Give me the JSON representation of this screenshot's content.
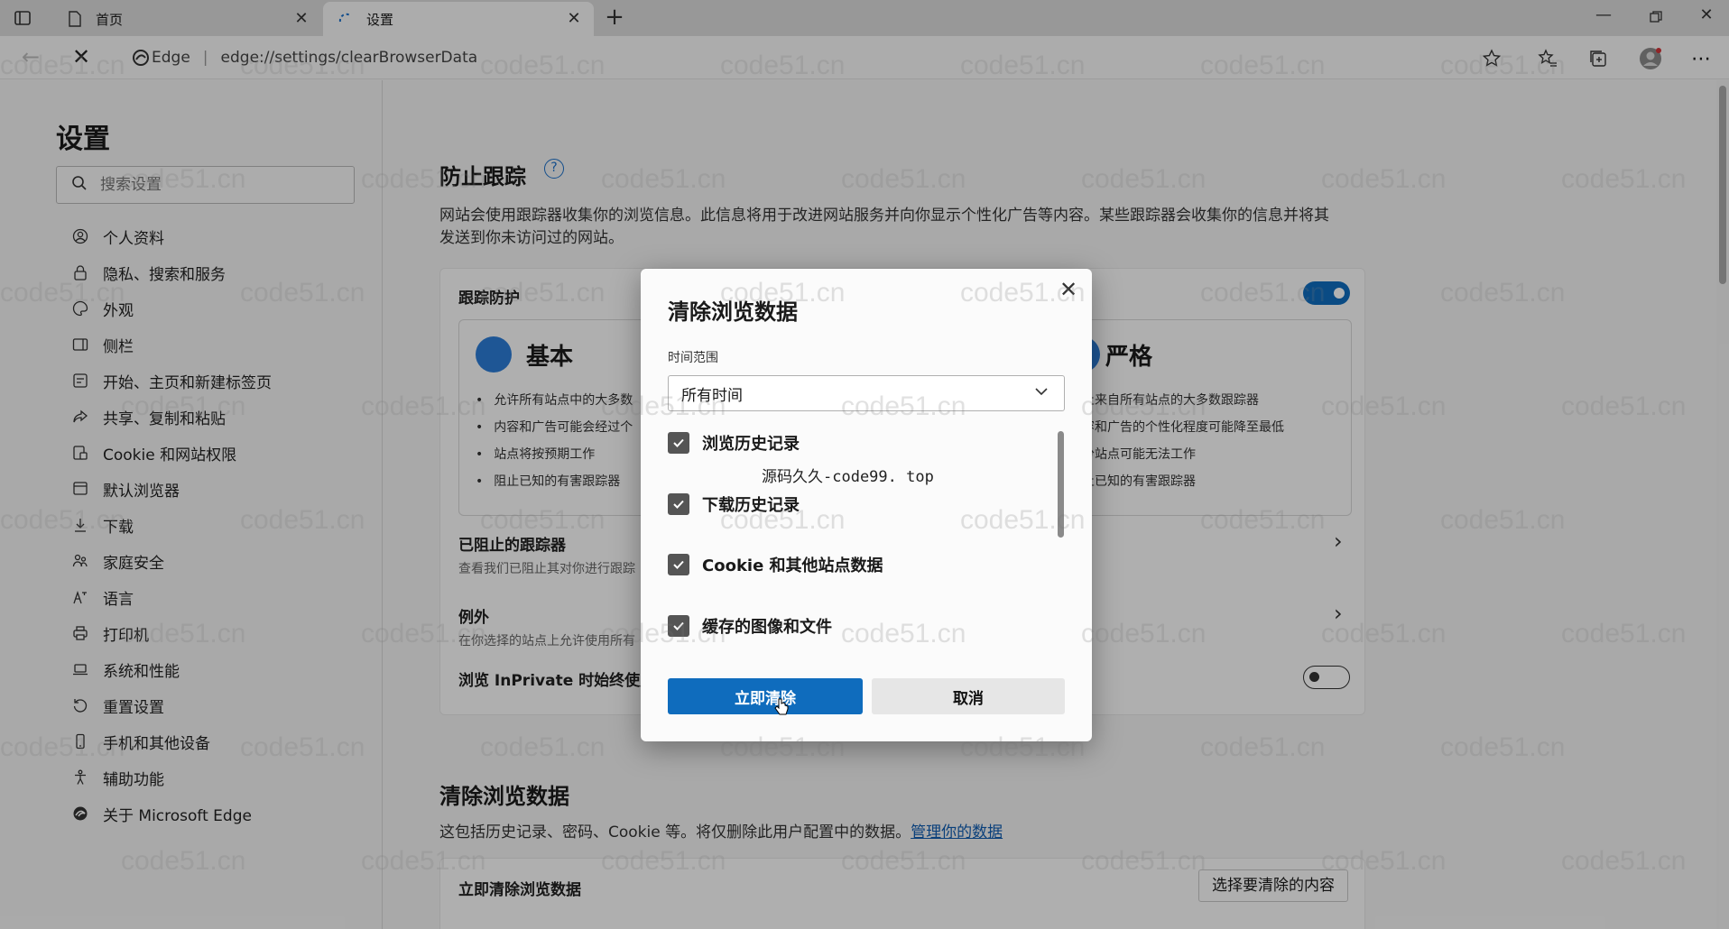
{
  "browser": {
    "tabs": [
      {
        "title": "首页",
        "icon": "page-icon",
        "active": false
      },
      {
        "title": "设置",
        "icon": "loading-icon",
        "active": true
      }
    ],
    "address": {
      "site_label": "Edge",
      "url": "edge://settings/clearBrowserData"
    }
  },
  "sidebar": {
    "title": "设置",
    "search_placeholder": "搜索设置",
    "items": [
      {
        "label": "个人资料",
        "icon": "profile-icon"
      },
      {
        "label": "隐私、搜索和服务",
        "icon": "lock-icon"
      },
      {
        "label": "外观",
        "icon": "palette-icon"
      },
      {
        "label": "侧栏",
        "icon": "sidebar-icon"
      },
      {
        "label": "开始、主页和新建标签页",
        "icon": "home-icon"
      },
      {
        "label": "共享、复制和粘贴",
        "icon": "share-icon"
      },
      {
        "label": "Cookie 和网站权限",
        "icon": "permissions-icon"
      },
      {
        "label": "默认浏览器",
        "icon": "browser-icon"
      },
      {
        "label": "下载",
        "icon": "download-icon"
      },
      {
        "label": "家庭安全",
        "icon": "family-icon"
      },
      {
        "label": "语言",
        "icon": "language-icon"
      },
      {
        "label": "打印机",
        "icon": "printer-icon"
      },
      {
        "label": "系统和性能",
        "icon": "laptop-icon"
      },
      {
        "label": "重置设置",
        "icon": "reset-icon"
      },
      {
        "label": "手机和其他设备",
        "icon": "phone-icon"
      },
      {
        "label": "辅助功能",
        "icon": "accessibility-icon"
      },
      {
        "label": "关于 Microsoft Edge",
        "icon": "edge-icon"
      }
    ]
  },
  "tracking": {
    "title": "防止跟踪",
    "description_line1": "网站会使用跟踪器收集你的浏览信息。此信息将用于改进网站服务并向你显示个性化广告等内容。某些跟踪器会收集你的信息并将其",
    "description_line2": "发送到你未访问过的网站。",
    "protection_label": "跟踪防护",
    "basic": {
      "title": "基本",
      "bullets": [
        "允许所有站点中的大多数",
        "内容和广告可能会经过个",
        "站点将按预期工作",
        "阻止已知的有害跟踪器"
      ]
    },
    "strict": {
      "title": "严格",
      "bullets": [
        "阻止来自所有站点的大多数跟踪器",
        "内容和广告的个性化程度可能降至最低",
        "部分站点可能无法工作",
        "阻止已知的有害跟踪器"
      ]
    },
    "blocked_label": "已阻止的跟踪器",
    "blocked_sub": "查看我们已阻止其对你进行跟踪",
    "exceptions_label": "例外",
    "exceptions_sub": "在你选择的站点上允许使用所有",
    "inprivate_label": "浏览 InPrivate 时始终使用"
  },
  "clear_section": {
    "title": "清除浏览数据",
    "description": "这包括历史记录、密码、Cookie 等。将仅删除此用户配置中的数据。",
    "link": "管理你的数据",
    "clear_now_label": "立即清除浏览数据",
    "choose_button": "选择要清除的内容"
  },
  "dialog": {
    "title": "清除浏览数据",
    "time_range_label": "时间范围",
    "time_range_value": "所有时间",
    "items": [
      {
        "label": "浏览历史记录",
        "checked": true
      },
      {
        "label": "下载历史记录",
        "checked": true
      },
      {
        "label": "Cookie 和其他站点数据",
        "checked": true
      },
      {
        "label": "缓存的图像和文件",
        "checked": true
      }
    ],
    "note": "源码久久-code99. top",
    "clear_button": "立即清除",
    "cancel_button": "取消"
  },
  "watermark": "code51.cn",
  "colors": {
    "accent": "#0f6cbd",
    "link": "#0f5cb0"
  }
}
